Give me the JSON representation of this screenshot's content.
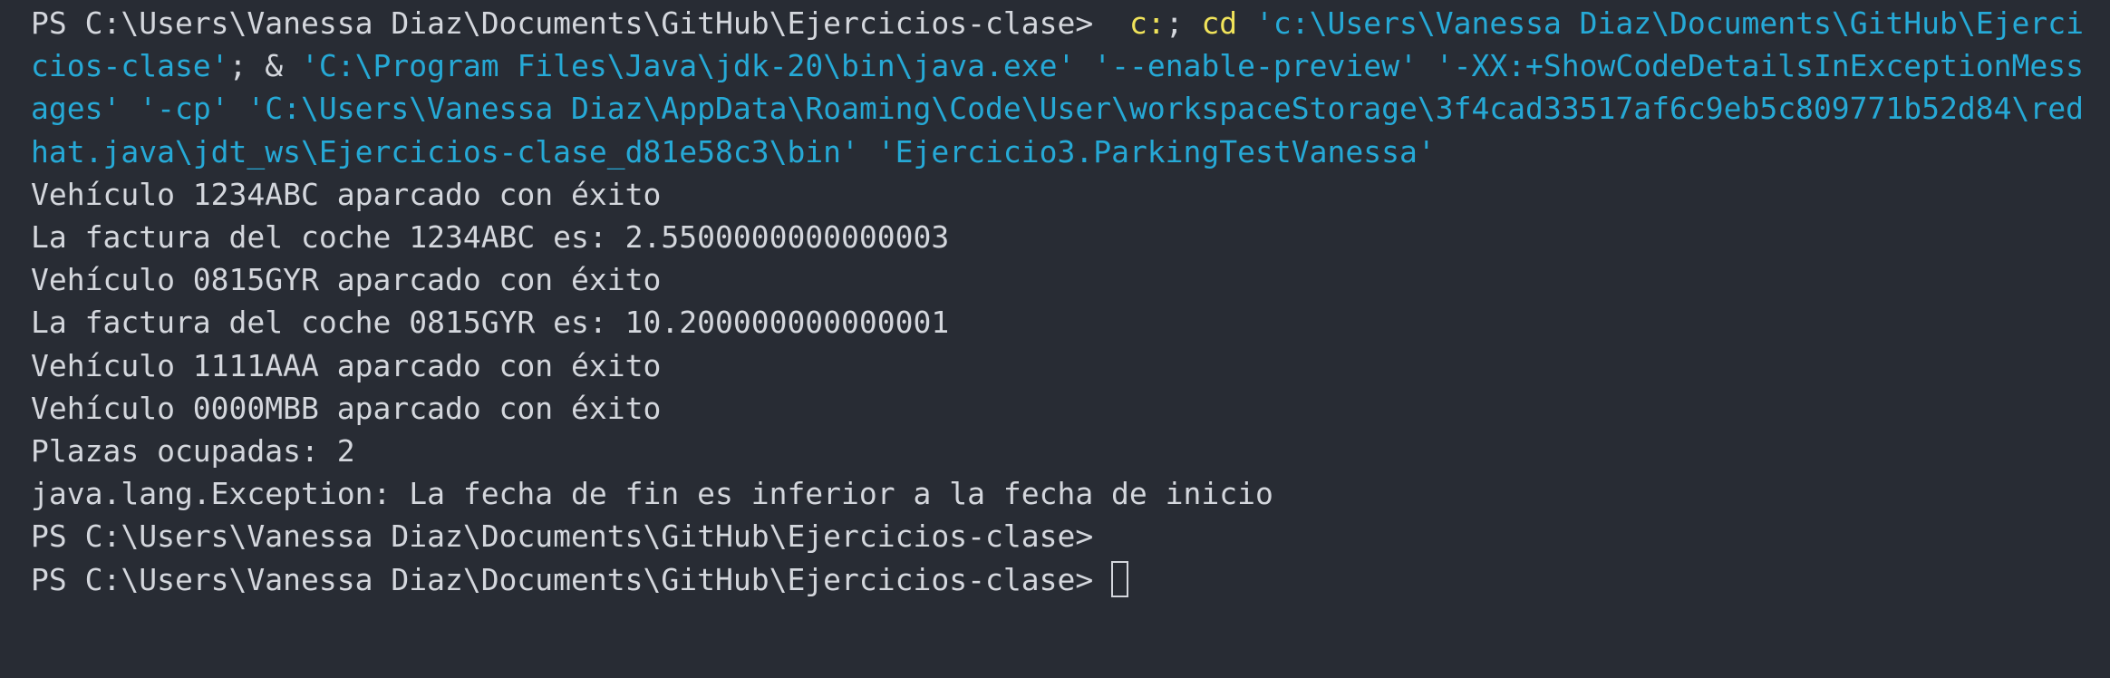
{
  "terminal": {
    "command": {
      "prompt": "PS C:\\Users\\Vanessa Diaz\\Documents\\GitHub\\Ejercicios-clase>  ",
      "seg1": "c:",
      "seg2": "; ",
      "seg3": "cd",
      "seg4": " ",
      "seg5": "'c:\\Users\\Vanessa Diaz\\Documents\\GitHub\\Ejercicios-clase'",
      "seg6": "; & ",
      "seg7": "'C:\\Program Files\\Java\\jdk-20\\bin\\java.exe'",
      "seg8": " ",
      "seg9": "'--enable-preview'",
      "seg10": " ",
      "seg11": "'-XX:+ShowCodeDetailsInExceptionMessages'",
      "seg12": " ",
      "seg13": "'-cp'",
      "seg14": " ",
      "seg15": "'C:\\Users\\Vanessa Diaz\\AppData\\Roaming\\Code\\User\\workspaceStorage\\3f4cad33517af6c9eb5c809771b52d84\\redhat.java\\jdt_ws\\Ejercicios-clase_d81e58c3\\bin'",
      "seg16": " ",
      "seg17": "'Ejercicio3.ParkingTestVanessa'"
    },
    "output": [
      "Vehículo 1234ABC aparcado con éxito",
      "La factura del coche 1234ABC es: 2.5500000000000003",
      "Vehículo 0815GYR aparcado con éxito",
      "La factura del coche 0815GYR es: 10.200000000000001",
      "Vehículo 1111AAA aparcado con éxito",
      "Vehículo 0000MBB aparcado con éxito",
      "Plazas ocupadas: 2",
      "java.lang.Exception: La fecha de fin es inferior a la fecha de inicio"
    ],
    "prompt_line_1": "PS C:\\Users\\Vanessa Diaz\\Documents\\GitHub\\Ejercicios-clase>",
    "prompt_line_2": "PS C:\\Users\\Vanessa Diaz\\Documents\\GitHub\\Ejercicios-clase> "
  },
  "colors": {
    "background": "#282c34",
    "text": "#d4d7dd",
    "keyword": "#f0e35a",
    "string": "#26a9d6"
  }
}
